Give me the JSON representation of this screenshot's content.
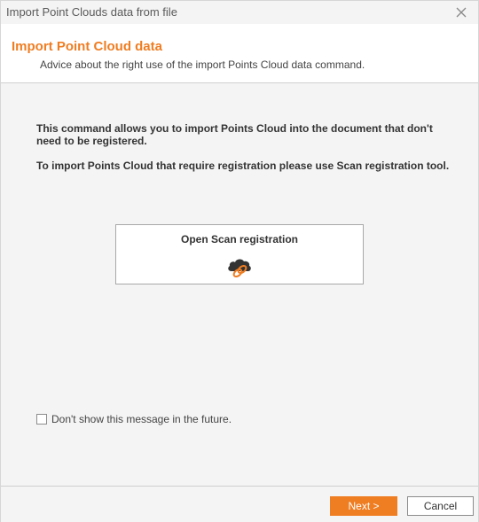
{
  "window": {
    "title": "Import Point Clouds data from file",
    "close_icon": "close-icon"
  },
  "header": {
    "heading": "Import Point Cloud data",
    "subheading": "Advice about the right use of the import Points Cloud data command."
  },
  "content": {
    "paragraph1": "This command allows you to import Points Cloud into the document that don't need to be registered.",
    "paragraph2": "To import Points Cloud that require registration please use Scan registration tool.",
    "scan_button": {
      "label": "Open Scan registration",
      "icon": "cloud-link-icon"
    },
    "checkbox": {
      "label": "Don't show this message in the future.",
      "checked": false
    }
  },
  "footer": {
    "next_label": "Next >",
    "cancel_label": "Cancel"
  },
  "colors": {
    "accent": "#ef7d22",
    "background": "#f4f4f4",
    "header_bg": "#ffffff"
  }
}
